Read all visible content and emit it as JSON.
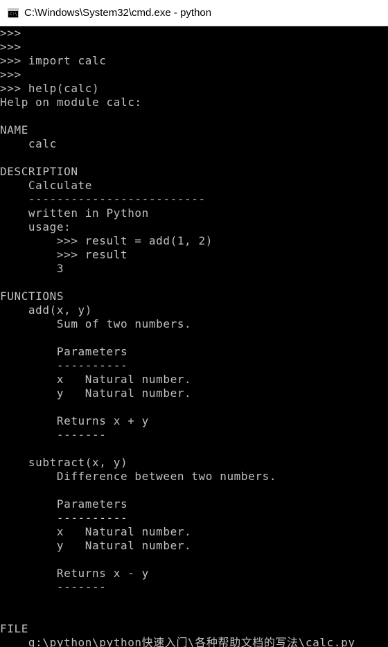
{
  "window": {
    "title": "C:\\Windows\\System32\\cmd.exe - python",
    "icon": "console-icon",
    "colors": {
      "background": "#000000",
      "foreground": "#c0c0c0",
      "titlebar": "#ffffff"
    }
  },
  "console": {
    "lines": [
      ">>>",
      ">>>",
      ">>> import calc",
      ">>>",
      ">>> help(calc)",
      "Help on module calc:",
      "",
      "NAME",
      "    calc",
      "",
      "DESCRIPTION",
      "    Calculate",
      "    -------------------------",
      "    written in Python",
      "    usage:",
      "        >>> result = add(1, 2)",
      "        >>> result",
      "        3",
      "",
      "FUNCTIONS",
      "    add(x, y)",
      "        Sum of two numbers.",
      "",
      "        Parameters",
      "        ----------",
      "        x   Natural number.",
      "        y   Natural number.",
      "",
      "        Returns x + y",
      "        -------",
      "",
      "    subtract(x, y)",
      "        Difference between two numbers.",
      "",
      "        Parameters",
      "        ----------",
      "        x   Natural number.",
      "        y   Natural number.",
      "",
      "        Returns x - y",
      "        -------",
      "",
      "",
      "FILE",
      "    g:\\python\\python快速入门\\各种帮助文档的写法\\calc.py"
    ]
  }
}
